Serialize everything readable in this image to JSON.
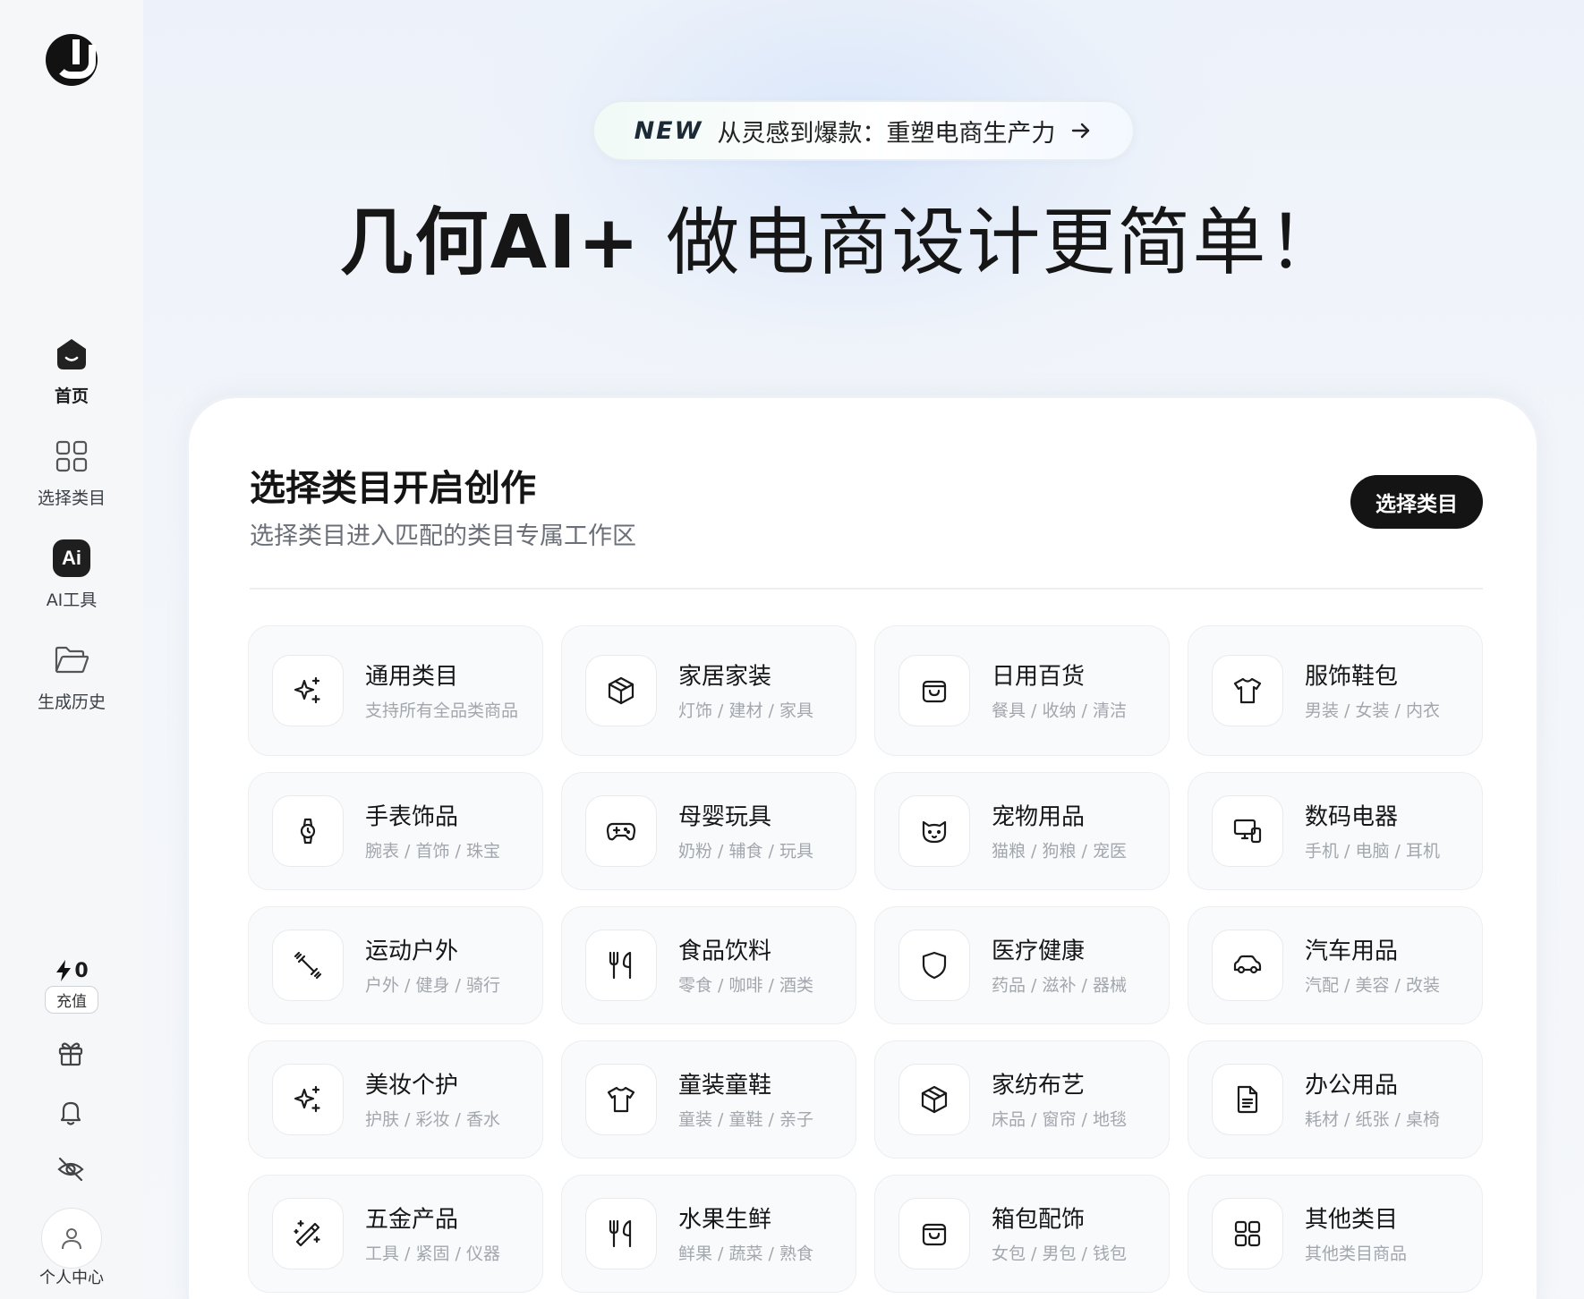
{
  "sidebar": {
    "nav": [
      {
        "id": "home",
        "label": "首页",
        "icon": "home-icon"
      },
      {
        "id": "categories",
        "label": "选择类目",
        "icon": "grid-icon"
      },
      {
        "id": "ai-tools",
        "label": "AI工具",
        "icon": "ai-badge-icon",
        "badge": "Ai"
      },
      {
        "id": "history",
        "label": "生成历史",
        "icon": "folder-icon"
      }
    ],
    "credits": "0",
    "recharge_label": "充值",
    "profile_label": "个人中心"
  },
  "hero": {
    "pill_new": "NEW",
    "pill_text": "从灵感到爆款：重塑电商生产力",
    "title_bold": "几何AI+",
    "title_rest": " 做电商设计更简单！"
  },
  "panel": {
    "title": "选择类目开启创作",
    "subtitle": "选择类目进入匹配的类目专属工作区",
    "select_button": "选择类目"
  },
  "categories": [
    {
      "name": "通用类目",
      "desc": "支持所有全品类商品",
      "icon": "sparkles-icon"
    },
    {
      "name": "家居家装",
      "desc": "灯饰 / 建材 / 家具",
      "icon": "box-icon"
    },
    {
      "name": "日用百货",
      "desc": "餐具 / 收纳 / 清洁",
      "icon": "shopping-bag-icon"
    },
    {
      "name": "服饰鞋包",
      "desc": "男装 / 女装 / 内衣",
      "icon": "shirt-icon"
    },
    {
      "name": "手表饰品",
      "desc": "腕表 / 首饰 / 珠宝",
      "icon": "watch-icon"
    },
    {
      "name": "母婴玩具",
      "desc": "奶粉 / 辅食 / 玩具",
      "icon": "gamepad-icon"
    },
    {
      "name": "宠物用品",
      "desc": "猫粮 / 狗粮 / 宠医",
      "icon": "cat-icon"
    },
    {
      "name": "数码电器",
      "desc": "手机 / 电脑 / 耳机",
      "icon": "devices-icon"
    },
    {
      "name": "运动户外",
      "desc": "户外 / 健身 / 骑行",
      "icon": "dumbbell-icon"
    },
    {
      "name": "食品饮料",
      "desc": "零食 / 咖啡 / 酒类",
      "icon": "utensils-icon"
    },
    {
      "name": "医疗健康",
      "desc": "药品 / 滋补 / 器械",
      "icon": "shield-icon"
    },
    {
      "name": "汽车用品",
      "desc": "汽配 / 美容 / 改装",
      "icon": "car-icon"
    },
    {
      "name": "美妆个护",
      "desc": "护肤 / 彩妆 / 香水",
      "icon": "sparkles-icon"
    },
    {
      "name": "童装童鞋",
      "desc": "童装 / 童鞋 / 亲子",
      "icon": "shirt-icon"
    },
    {
      "name": "家纺布艺",
      "desc": "床品 / 窗帘 / 地毯",
      "icon": "box-icon"
    },
    {
      "name": "办公用品",
      "desc": "耗材 / 纸张 / 桌椅",
      "icon": "document-icon"
    },
    {
      "name": "五金产品",
      "desc": "工具 / 紧固 / 仪器",
      "icon": "magic-wand-icon"
    },
    {
      "name": "水果生鲜",
      "desc": "鲜果 / 蔬菜 / 熟食",
      "icon": "utensils-icon"
    },
    {
      "name": "箱包配饰",
      "desc": "女包 / 男包 / 钱包",
      "icon": "shopping-bag-icon"
    },
    {
      "name": "其他类目",
      "desc": "其他类目商品",
      "icon": "grid-icon"
    }
  ]
}
